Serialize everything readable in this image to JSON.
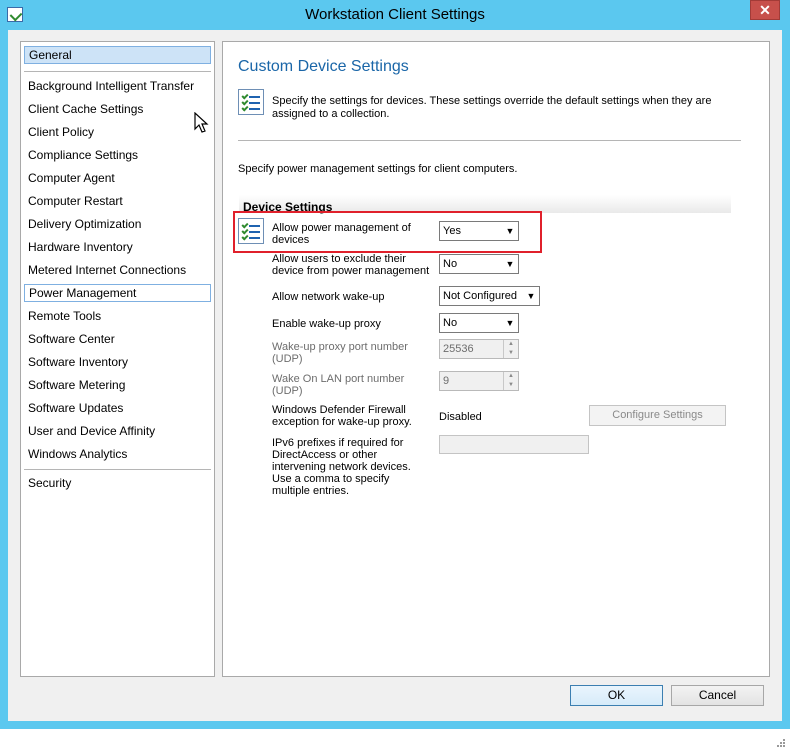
{
  "window": {
    "title": "Workstation Client Settings",
    "close_glyph": "✕"
  },
  "sidebar": {
    "items": [
      {
        "label": "General"
      },
      {
        "label": "Background Intelligent Transfer"
      },
      {
        "label": "Client Cache Settings"
      },
      {
        "label": "Client Policy"
      },
      {
        "label": "Compliance Settings"
      },
      {
        "label": "Computer Agent"
      },
      {
        "label": "Computer Restart"
      },
      {
        "label": "Delivery Optimization"
      },
      {
        "label": "Hardware Inventory"
      },
      {
        "label": "Metered Internet Connections"
      },
      {
        "label": "Power Management"
      },
      {
        "label": "Remote Tools"
      },
      {
        "label": "Software Center"
      },
      {
        "label": "Software Inventory"
      },
      {
        "label": "Software Metering"
      },
      {
        "label": "Software Updates"
      },
      {
        "label": "User and Device Affinity"
      },
      {
        "label": "Windows Analytics"
      },
      {
        "label": "Security"
      }
    ],
    "selected": "General",
    "focused": "Power Management"
  },
  "main": {
    "heading": "Custom Device Settings",
    "description": "Specify the settings for devices. These settings override the default settings when they are assigned to a collection.",
    "power_description": "Specify power management settings for client computers.",
    "section_title": "Device Settings",
    "settings": {
      "allow_power_mgmt": {
        "label": "Allow power management of devices",
        "value": "Yes"
      },
      "allow_exclude": {
        "label": "Allow users to exclude their device from power management",
        "value": "No"
      },
      "allow_wakeup": {
        "label": "Allow network wake-up",
        "value": "Not Configured"
      },
      "enable_wakeup_proxy": {
        "label": "Enable wake-up proxy",
        "value": "No"
      },
      "proxy_port": {
        "label": "Wake-up proxy port number (UDP)",
        "value": "25536"
      },
      "wol_port": {
        "label": "Wake On LAN port number (UDP)",
        "value": "9"
      },
      "firewall": {
        "label": "Windows Defender Firewall exception for wake-up proxy.",
        "value": "Disabled",
        "button": "Configure Settings"
      },
      "ipv6": {
        "label": "IPv6 prefixes if required for DirectAccess or other intervening network devices. Use a comma to specify multiple entries.",
        "value": ""
      }
    },
    "highlighted_setting": "allow_power_mgmt"
  },
  "footer": {
    "ok_label": "OK",
    "cancel_label": "Cancel"
  },
  "colors": {
    "window_frame": "#5bc8ef",
    "heading": "#1a66a8",
    "highlight_border": "#e0202b",
    "close_button": "#c7504b"
  }
}
